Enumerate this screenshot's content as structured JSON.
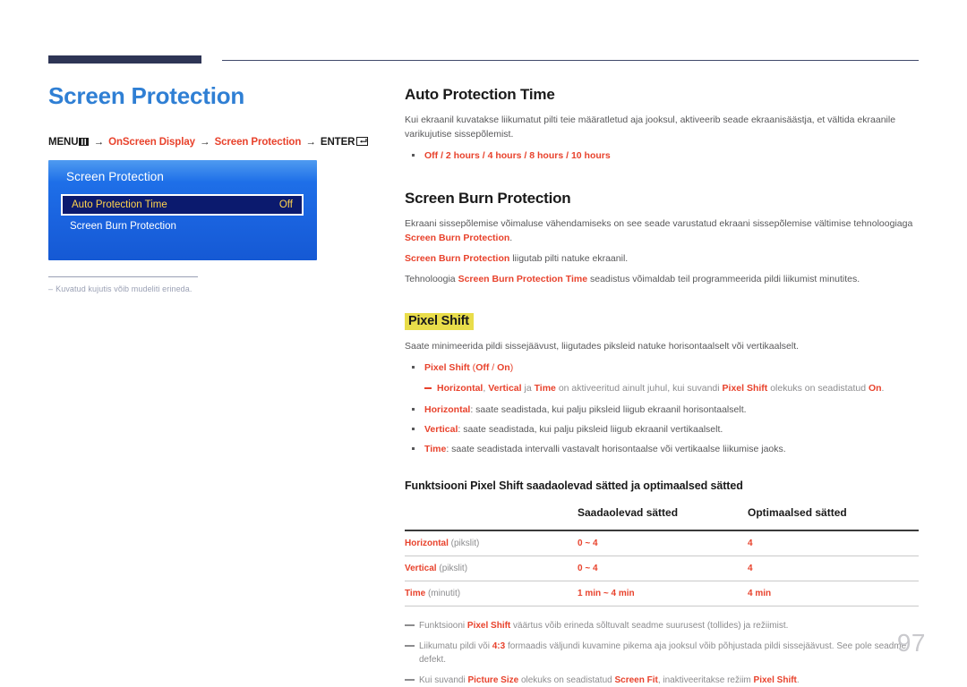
{
  "header": {
    "bar_color": "#2e3555",
    "line_color": "#404a6b"
  },
  "left": {
    "page_title": "Screen Protection",
    "menu_path": {
      "menu_label": "MENU",
      "menu_icon": "menu-grid-icon",
      "arrow": "→",
      "step1": "OnScreen Display",
      "step2": "Screen Protection",
      "enter_label": "ENTER",
      "enter_icon": "enter-return-icon"
    },
    "osd": {
      "title": "Screen Protection",
      "selected_row_label": "Auto Protection Time",
      "selected_row_value": "Off",
      "row2_label": "Screen Burn Protection"
    },
    "note": "Kuvatud kujutis võib mudeliti erineda."
  },
  "right": {
    "section1": {
      "heading": "Auto Protection Time",
      "paragraph": "Kui ekraanil kuvatakse liikumatut pilti teie määratletud aja jooksul, aktiveerib seade ekraanisäästja, et vältida ekraanile varikujutise sissepõlemist.",
      "options": "Off / 2 hours / 4 hours / 8 hours / 10 hours"
    },
    "section2": {
      "heading": "Screen Burn Protection",
      "para1_a": "Ekraani sissepõlemise võimaluse vähendamiseks on see seade varustatud ekraani sissepõlemise vältimise tehnoloogiaga ",
      "para1_b": "Screen Burn Protection",
      "para1_c": ".",
      "para2_a": "Screen Burn Protection",
      "para2_b": " liigutab pilti natuke ekraanil.",
      "para3_a": "Tehnoloogia ",
      "para3_b": "Screen Burn Protection Time",
      "para3_c": " seadistus võimaldab teil programmeerida pildi liikumist minutites."
    },
    "section3": {
      "heading": "Pixel Shift",
      "highlight_color": "#e9dd4a",
      "paragraph": "Saate minimeerida pildi sissejäävust, liigutades piksleid natuke horisontaalselt või vertikaalselt.",
      "bullets": [
        {
          "term": "Pixel Shift",
          "rest_plain": " (",
          "opt1": "Off",
          "sep": " / ",
          "opt2": "On",
          "rest_end": ")"
        }
      ],
      "subnote": {
        "t1": "Horizontal",
        "s1": ", ",
        "t2": "Vertical",
        "s2": " ja ",
        "t3": "Time",
        "s3": " on aktiveeritud ainult juhul, kui suvandi ",
        "t4": "Pixel Shift",
        "s4": " olekuks on seadistatud ",
        "t5": "On",
        "s5": "."
      },
      "bullets2": [
        {
          "term": "Horizontal",
          "desc": ": saate seadistada, kui palju piksleid liigub ekraanil horisontaalselt."
        },
        {
          "term": "Vertical",
          "desc": ": saate seadistada, kui palju piksleid liigub ekraanil vertikaalselt."
        },
        {
          "term": "Time",
          "desc": ": saate seadistada intervalli vastavalt horisontaalse või vertikaalse liikumise jaoks."
        }
      ]
    },
    "table": {
      "title": "Funktsiooni Pixel Shift saadaolevad sätted ja optimaalsed sätted",
      "headers": [
        "",
        "Saadaolevad sätted",
        "Optimaalsed sätted"
      ],
      "rows": [
        {
          "term": "Horizontal",
          "unit": " (pikslit)",
          "available": "0 ~ 4",
          "optimal": "4"
        },
        {
          "term": "Vertical",
          "unit": " (pikslit)",
          "available": "0 ~ 4",
          "optimal": "4"
        },
        {
          "term": "Time",
          "unit": " (minutit)",
          "available": "1 min ~ 4 min",
          "optimal": "4 min"
        }
      ]
    },
    "footnotes": [
      {
        "a": "Funktsiooni ",
        "b": "Pixel Shift",
        "c": " väärtus võib erineda sõltuvalt seadme suurusest (tollides) ja režiimist."
      },
      {
        "a": "Liikumatu pildi või ",
        "b": "4:3",
        "c": " formaadis väljundi kuvamine pikema aja jooksul võib põhjustada pildi sissejäävust. See pole seadme defekt."
      },
      {
        "a": "Kui suvandi ",
        "b": "Picture Size",
        "c": " olekuks on seadistatud ",
        "d": "Screen Fit",
        "e": ", inaktiveeritakse režiim ",
        "f": "Pixel Shift",
        "g": "."
      }
    ]
  },
  "page_number": "97"
}
